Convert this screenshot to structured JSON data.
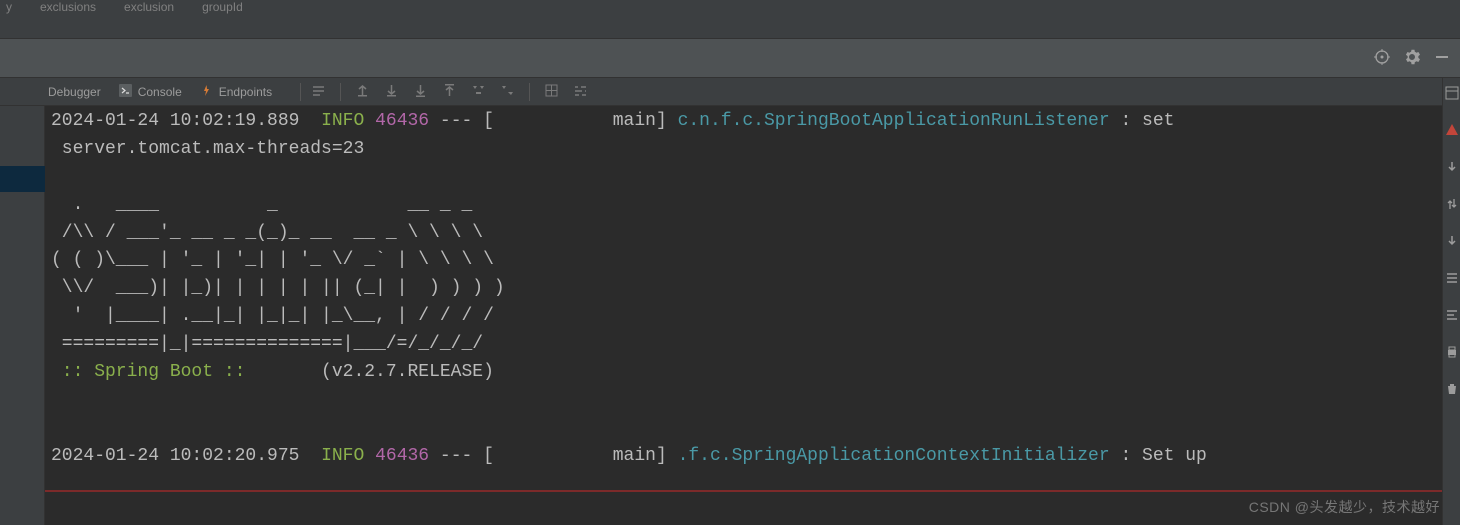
{
  "crumbs": {
    "a": "y",
    "b": "exclusions",
    "c": "exclusion",
    "d": "groupId"
  },
  "tabs": {
    "debugger": "Debugger",
    "console": "Console",
    "endpoints": "Endpoints"
  },
  "log": {
    "l1_ts": "2024-01-24 10:02:19.889",
    "l1_level": "INFO",
    "l1_pid": "46436",
    "l1_dash": " --- [",
    "l1_thread": "           main] ",
    "l1_class": "c.n.f.c.SpringBootApplicationRunListener",
    "l1_msg": " : set",
    "l2": " server.tomcat.max-threads=23",
    "banner_a": "  .   ____          _            __ _ _",
    "banner_b": " /\\\\ / ___'_ __ _ _(_)_ __  __ _ \\ \\ \\ \\",
    "banner_c": "( ( )\\___ | '_ | '_| | '_ \\/ _` | \\ \\ \\ \\",
    "banner_d": " \\\\/  ___)| |_)| | | | | || (_| |  ) ) ) )",
    "banner_e": "  '  |____| .__|_| |_|_| |_\\__, | / / / /",
    "banner_f": " =========|_|==============|___/=/_/_/_/",
    "banner_g1": " :: Spring Boot ::",
    "banner_g2": "       (v2.2.7.RELEASE)",
    "l3_ts": "2024-01-24 10:02:20.975",
    "l3_level": "INFO",
    "l3_pid": "46436",
    "l3_dash": " --- [",
    "l3_thread": "           main] ",
    "l3_class": ".f.c.SpringApplicationContextInitializer",
    "l3_msg": " : Set up"
  },
  "watermark": "CSDN @头发越少，技术越好"
}
